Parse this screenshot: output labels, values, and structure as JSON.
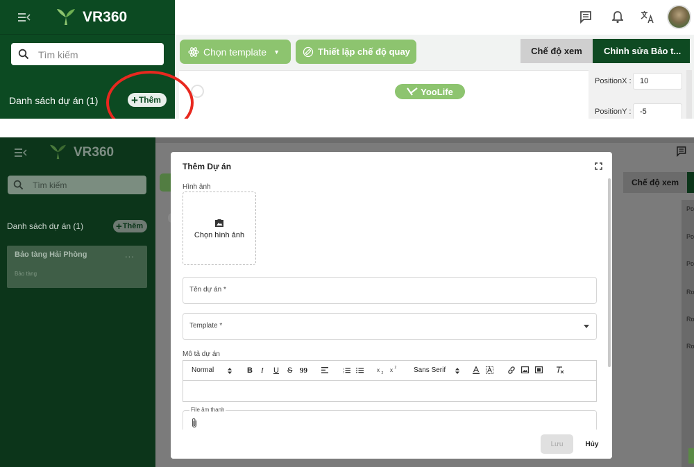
{
  "top": {
    "app_name": "VR360",
    "search_placeholder": "Tìm kiếm",
    "project_list_title": "Danh sách dự án (1)",
    "add_button_label": "Thêm",
    "template_button": "Chọn template",
    "rotation_button": "Thiết lập chế độ quay",
    "mode_view": "Chế độ xem",
    "mode_edit": "Chỉnh sửa Bảo t...",
    "brand_badge": "YooLife",
    "position_x_label": "PositionX :",
    "position_x_value": "10",
    "position_y_label": "PositionY :",
    "position_y_value": "-5",
    "highlight_color": "#e8281f"
  },
  "bottom": {
    "app_name": "VR360",
    "search_placeholder": "Tìm kiếm",
    "project_list_title": "Danh sách dự án (1)",
    "add_button_label": "Thêm",
    "project": {
      "name": "Bảo tàng Hải Phòng",
      "type": "Bảo tàng",
      "more": "..."
    },
    "mode_view": "Chế độ xem",
    "right_labels": [
      "Po",
      "Po",
      "Po",
      "Ro",
      "Ro",
      "Ro"
    ],
    "modal": {
      "title": "Thêm Dự án",
      "image_label": "Hình ảnh",
      "image_button": "Chọn hình ảnh",
      "name_label": "Tên dự án *",
      "template_label": "Template *",
      "description_label": "Mô tả dự án",
      "toolbar": {
        "heading_select": "Normal",
        "bold": "B",
        "italic": "I",
        "underline": "U",
        "strike": "S",
        "quote": "99",
        "font_select": "Sans Serif"
      },
      "audio_label": "File âm thanh",
      "save_button": "Lưu",
      "cancel_button": "Hủy"
    }
  },
  "colors": {
    "brand_green": "#0c4a22",
    "accent_green": "#8dc46f"
  }
}
